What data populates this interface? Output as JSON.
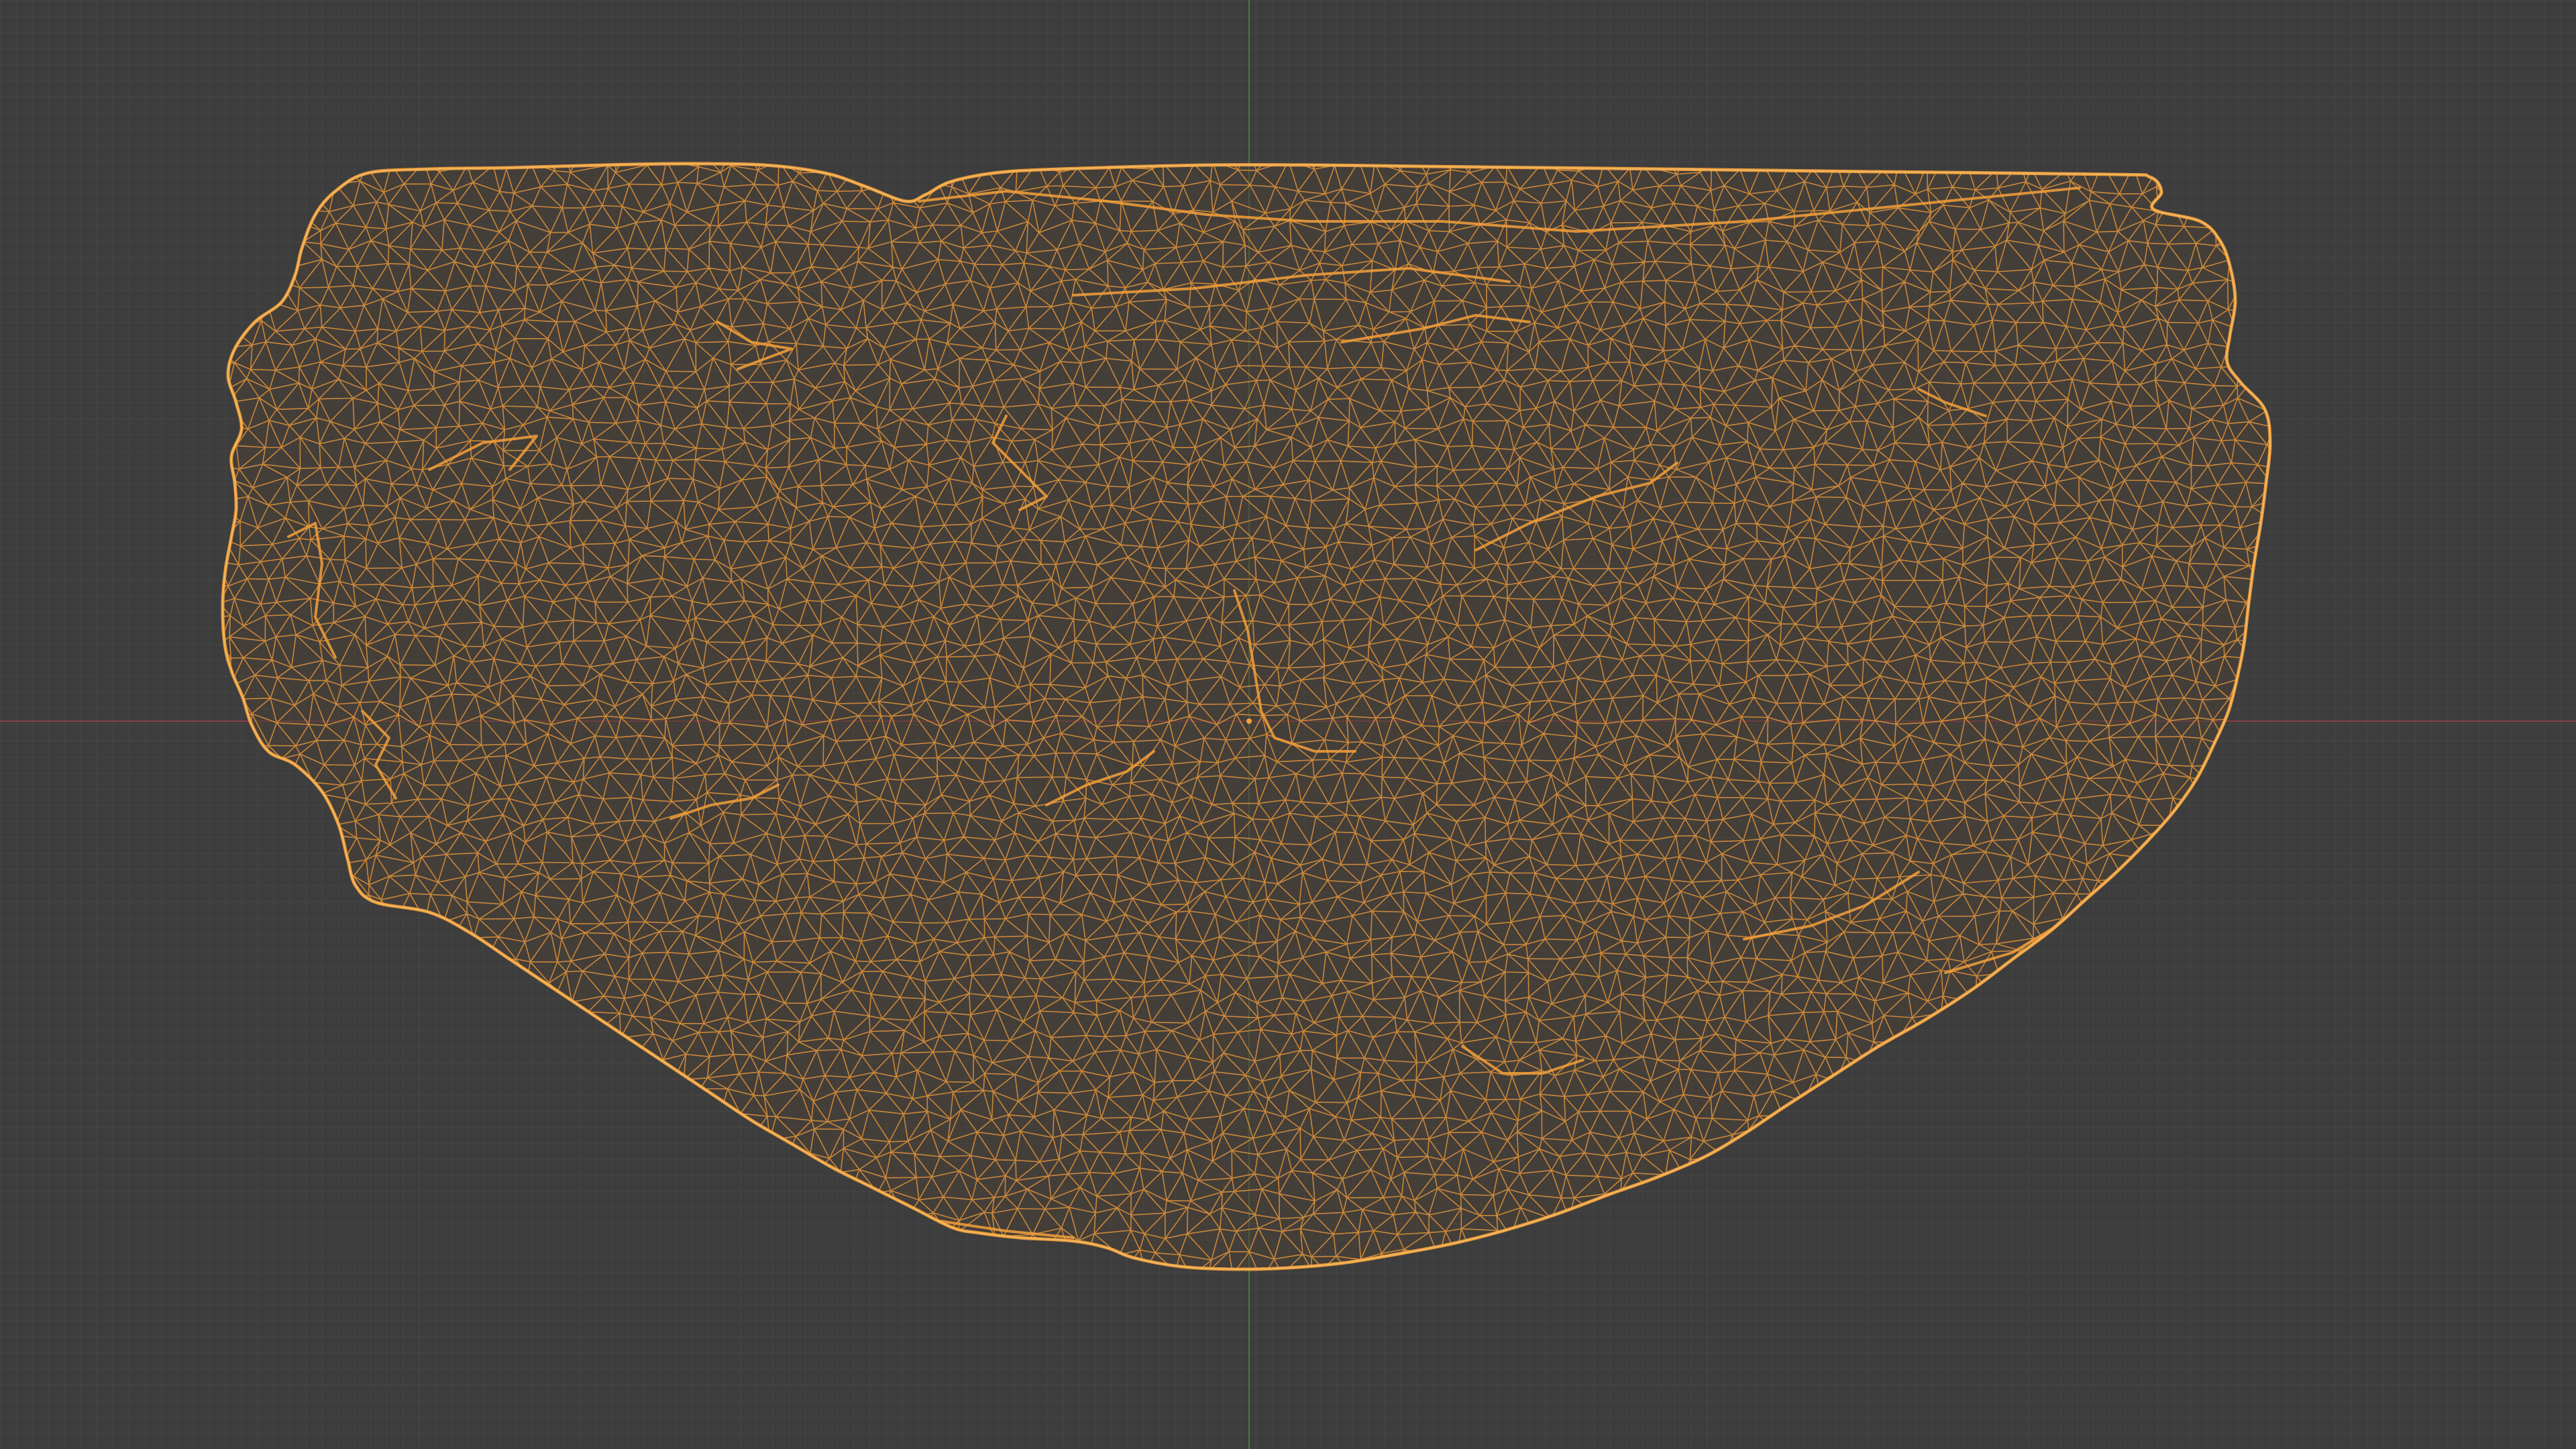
{
  "viewport": {
    "mode": "wireframe",
    "view": "orthographic",
    "object_kind": "mesh",
    "object_selected": true,
    "grid_visible": true
  },
  "colors": {
    "background": "#3d3d3d",
    "grid_line": "#464646",
    "x_axis": "#8a3f47",
    "y_axis": "#4b7a3b",
    "wire_selected": "#f5a03a",
    "wire_fill": "#4a4036"
  },
  "icons": {
    "origin": "origin-dot-icon"
  }
}
